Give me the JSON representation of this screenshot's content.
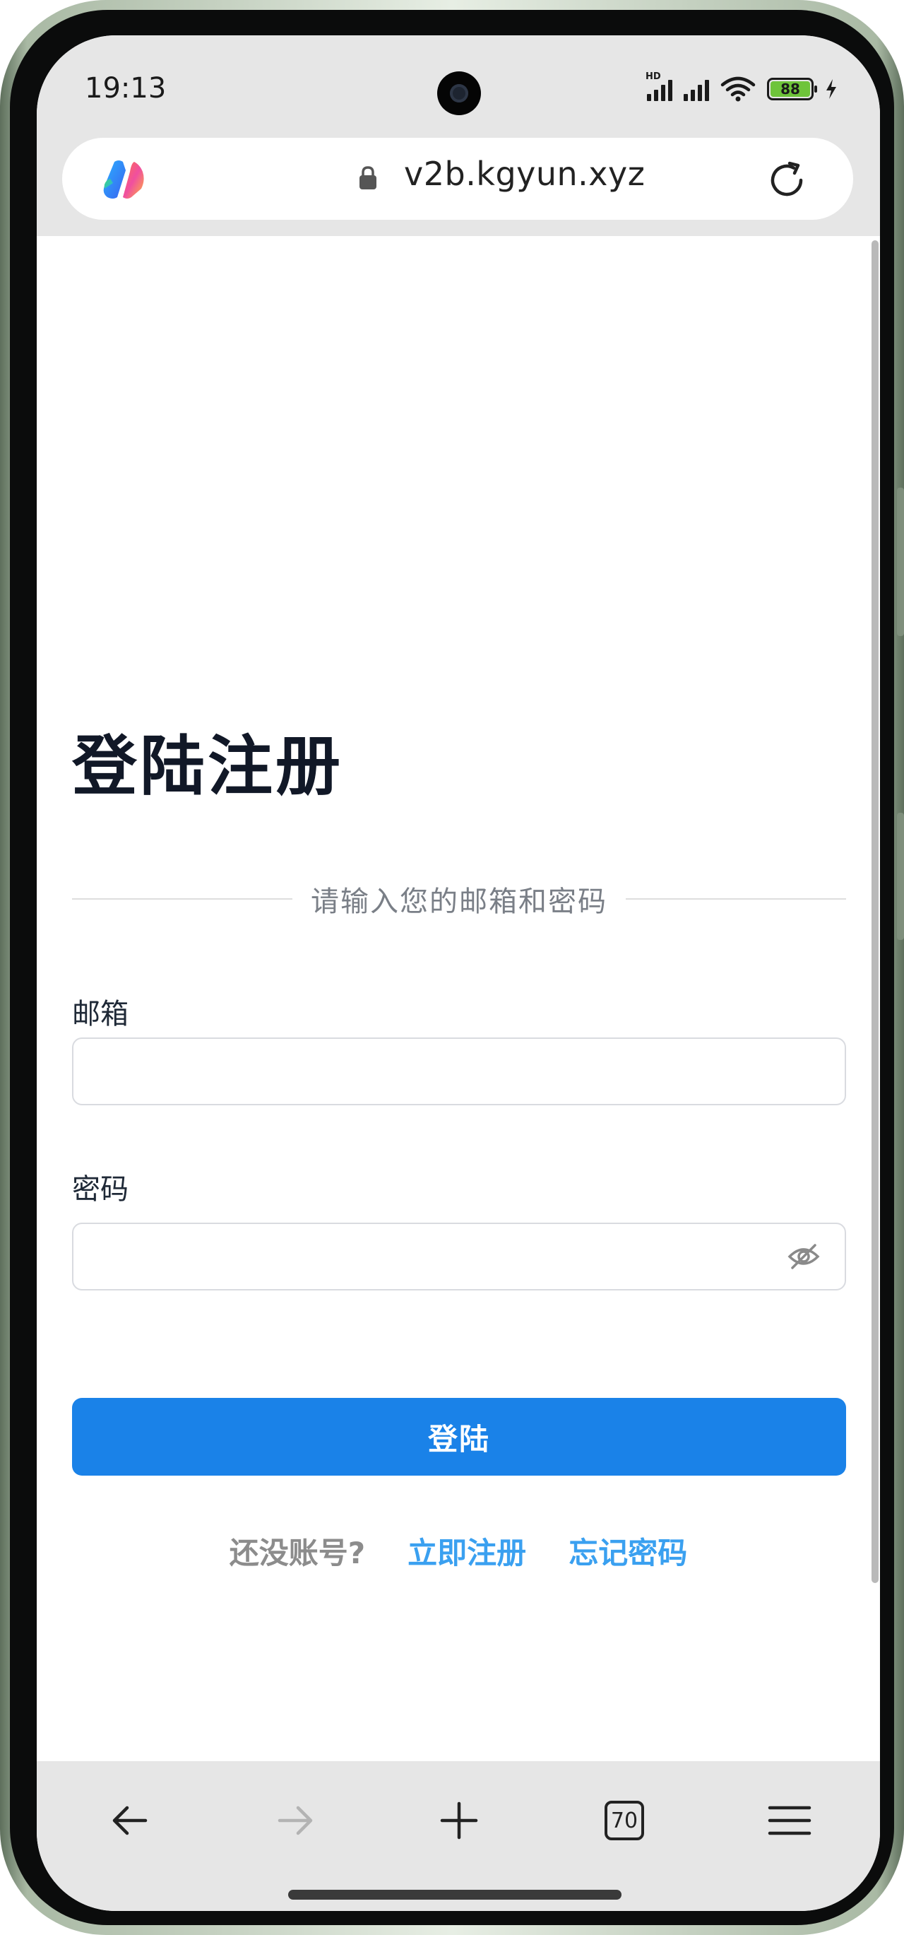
{
  "status_bar": {
    "time": "19:13",
    "network_tag": "HD",
    "battery": "88",
    "icons": [
      "signal-icon",
      "wifi-icon",
      "battery-icon",
      "charging-bolt-icon"
    ]
  },
  "browser": {
    "url": "v2b.kgyun.xyz",
    "tab_count": "70",
    "icons": [
      "copilot-logo-icon",
      "lock-icon",
      "reload-icon",
      "back-arrow-icon",
      "forward-arrow-icon",
      "plus-icon",
      "tabs-icon",
      "menu-icon"
    ]
  },
  "page": {
    "title": "登陆注册",
    "subtitle": "请输入您的邮箱和密码",
    "email_label": "邮箱",
    "email_value": "",
    "password_label": "密码",
    "password_value": "",
    "login_button": "登陆",
    "no_account_text": "还没账号?",
    "register_link": "立即注册",
    "forgot_link": "忘记密码"
  },
  "colors": {
    "primary": "#1a82e8",
    "link": "#3aa0f0",
    "title": "#111827"
  }
}
